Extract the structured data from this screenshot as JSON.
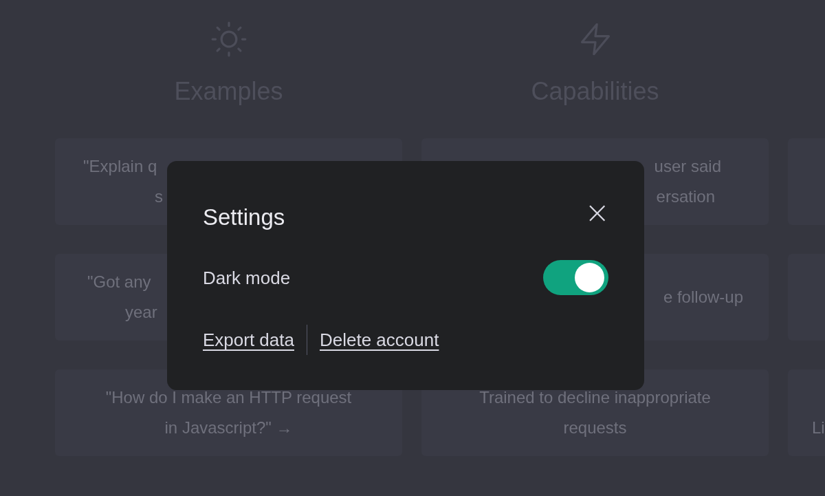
{
  "columns": [
    {
      "heading": "Examples",
      "cards": [
        {
          "lines": [
            {
              "text": "\"Explain q"
            },
            {
              "text": "s"
            }
          ]
        },
        {
          "lines": [
            {
              "text": "\"Got any"
            },
            {
              "text": "year"
            }
          ]
        },
        {
          "lines": [
            {
              "text": "\"How do I make an HTTP request"
            },
            {
              "text": "in Javascript?\" →"
            }
          ]
        }
      ]
    },
    {
      "heading": "Capabilities",
      "cards": [
        {
          "lines": [
            {
              "text": "user said"
            },
            {
              "text": "ersation"
            }
          ]
        },
        {
          "lines": [
            {
              "text": "e follow-up"
            }
          ]
        },
        {
          "lines": [
            {
              "text": "Trained to decline inappropriate"
            },
            {
              "text": "requests"
            }
          ]
        }
      ]
    },
    {
      "cards": [
        {
          "lines": [
            {
              "text": "Li"
            }
          ]
        }
      ]
    }
  ],
  "dialog": {
    "title": "Settings",
    "close": "×",
    "settings": [
      {
        "label": "Dark mode",
        "on": true
      }
    ],
    "links": [
      "Export data",
      "Delete account"
    ]
  }
}
